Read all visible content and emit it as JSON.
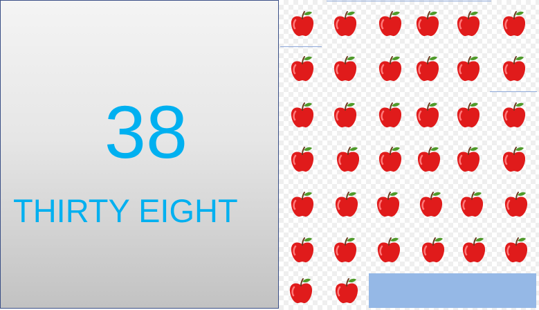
{
  "number_card": {
    "numeral": "38",
    "words": "THIRTY EIGHT",
    "text_color": "#00b0f0"
  },
  "apples": {
    "count": 38,
    "icon": "apple-icon",
    "colors": {
      "body": "#e01b1b",
      "highlight": "#ff7a7a",
      "stem": "#6b3a1e",
      "leaf": "#4f9a2a"
    }
  }
}
